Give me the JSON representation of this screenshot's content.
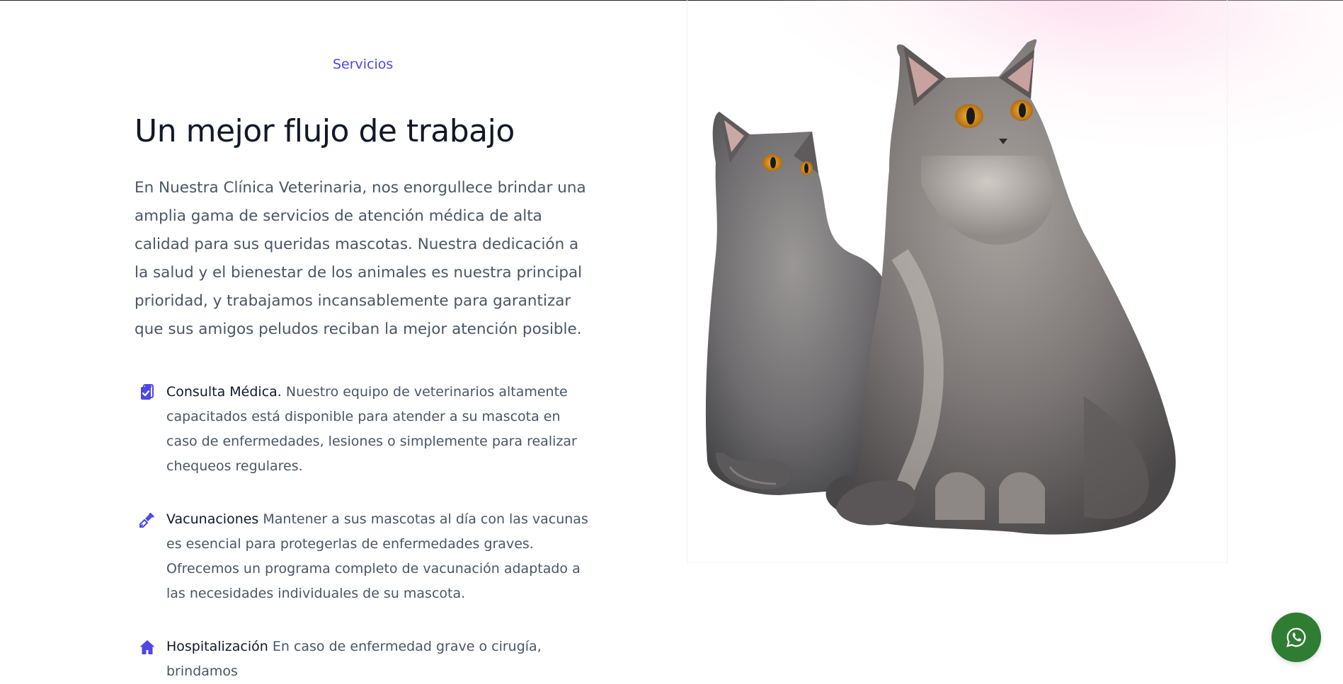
{
  "section": {
    "eyebrow": "Servicios",
    "headline": "Un mejor flujo de trabajo",
    "lead": "En Nuestra Clínica Veterinaria, nos enorgullece brindar una amplia gama de servicios de atención médica de alta calidad para sus queridas mascotas. Nuestra dedicación a la salud y el bienestar de los animales es nuestra principal prioridad, y trabajamos incansablemente para garantizar que sus amigos peludos reciban la mejor atención posible."
  },
  "features": [
    {
      "icon": "clipboard-check-icon",
      "title": "Consulta Médica.",
      "description": "Nuestro equipo de veterinarios altamente capacitados está disponible para atender a su mascota en caso de enfermedades, lesiones o simplemente para realizar chequeos regulares."
    },
    {
      "icon": "syringe-icon",
      "title": "Vacunaciones",
      "description": "Mantener a sus mascotas al día con las vacunas es esencial para protegerlas de enfermedades graves. Ofrecemos un programa completo de vacunación adaptado a las necesidades individuales de su mascota."
    },
    {
      "icon": "home-icon",
      "title": "Hospitalización",
      "description": "En caso de enfermedad grave o cirugía, brindamos"
    }
  ],
  "image": {
    "subject": "two-gray-cats-photo"
  },
  "chat": {
    "icon": "whatsapp-icon"
  },
  "colors": {
    "accent": "#4f46e5",
    "heading": "#111827",
    "body": "#4b5563",
    "whatsapp": "#2e7d32"
  }
}
